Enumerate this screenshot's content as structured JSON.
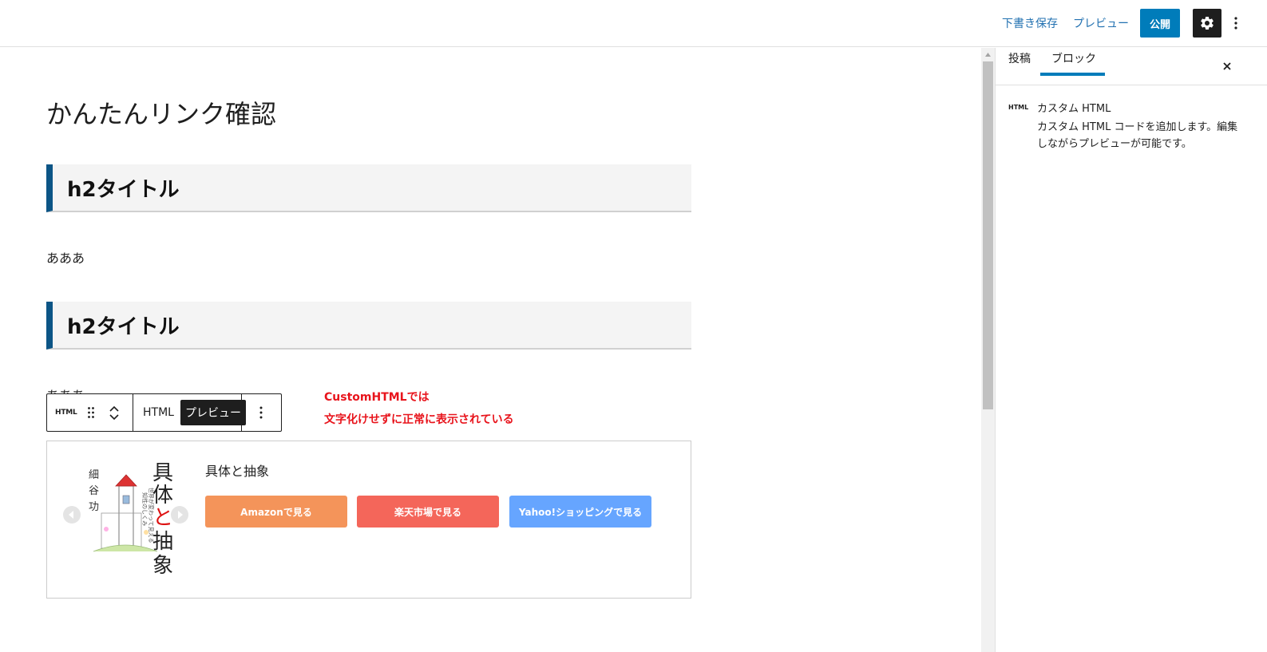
{
  "topbar": {
    "save_draft": "下書き保存",
    "preview": "プレビュー",
    "publish": "公開"
  },
  "editor": {
    "post_title": "かんたんリンク確認",
    "heading_1": "h2タイトル",
    "paragraph_1": "あああ",
    "heading_2": "h2タイトル",
    "paragraph_2": "あああ"
  },
  "block_toolbar": {
    "block_type": "HTML",
    "tab_html": "HTML",
    "tab_preview": "プレビュー"
  },
  "annotation": {
    "line_1": "CustomHTMLでは",
    "line_2": "文字化けせずに正常に表示されている",
    "color": "#e8141c"
  },
  "product": {
    "title": "具体と抽象",
    "cover_author": "細谷功",
    "cover_title_1": "具体",
    "cover_title_2": "と",
    "cover_title_3": "抽象",
    "cover_subtitle": "世界が変わって見える知性のしくみ",
    "buttons": [
      {
        "label": "Amazonで見る",
        "color": "#f4945a"
      },
      {
        "label": "楽天市場で見る",
        "color": "#f4665a"
      },
      {
        "label": "Yahoo!ショッピングで見る",
        "color": "#66a5ff"
      }
    ]
  },
  "sidebar": {
    "tab_post": "投稿",
    "tab_block": "ブロック",
    "block_icon": "HTML",
    "block_title": "カスタム HTML",
    "block_description": "カスタム HTML コードを追加します。編集しながらプレビューが可能です。"
  }
}
